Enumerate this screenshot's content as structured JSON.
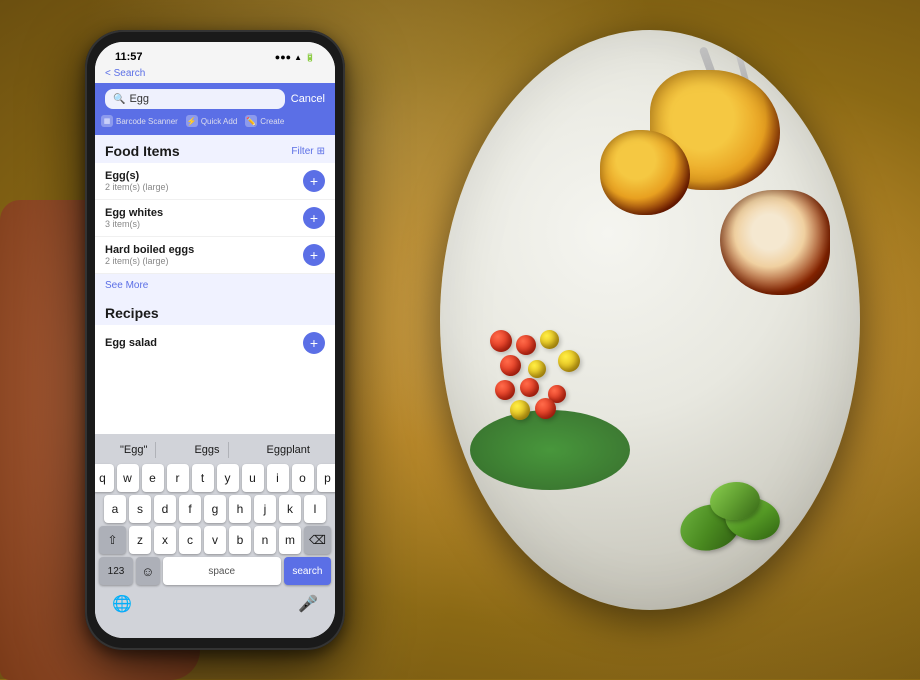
{
  "background": {
    "description": "Granite countertop with plate of food and hand holding phone"
  },
  "phone": {
    "status_bar": {
      "time": "11:57",
      "signal": "●●●",
      "wifi": "wifi",
      "battery": "70"
    },
    "nav": {
      "back_label": "< Search"
    },
    "search": {
      "placeholder": "Egg",
      "cancel_label": "Cancel"
    },
    "quick_actions": [
      {
        "icon": "barcode",
        "label": "Barcode Scanner"
      },
      {
        "icon": "plus",
        "label": "Quick Add"
      },
      {
        "icon": "pencil",
        "label": "Create"
      }
    ],
    "food_items": {
      "section_title": "Food Items",
      "filter_label": "Filter",
      "items": [
        {
          "name": "Egg(s)",
          "serving": "2 item(s) (large)"
        },
        {
          "name": "Egg whites",
          "serving": "3 item(s)"
        },
        {
          "name": "Hard boiled eggs",
          "serving": "2 item(s) (large)"
        }
      ],
      "see_more_label": "See More"
    },
    "recipes": {
      "section_title": "Recipes",
      "items": [
        {
          "name": "Egg salad"
        }
      ]
    },
    "keyboard": {
      "autocomplete": [
        "\"Egg\"",
        "Eggs",
        "Eggplant"
      ],
      "rows": [
        [
          "q",
          "w",
          "e",
          "r",
          "t",
          "y",
          "u",
          "i",
          "o",
          "p"
        ],
        [
          "a",
          "s",
          "d",
          "f",
          "g",
          "h",
          "j",
          "k",
          "l"
        ],
        [
          "z",
          "x",
          "c",
          "v",
          "b",
          "n",
          "m"
        ]
      ],
      "space_label": "space",
      "search_label": "search",
      "numbers_label": "123"
    }
  }
}
